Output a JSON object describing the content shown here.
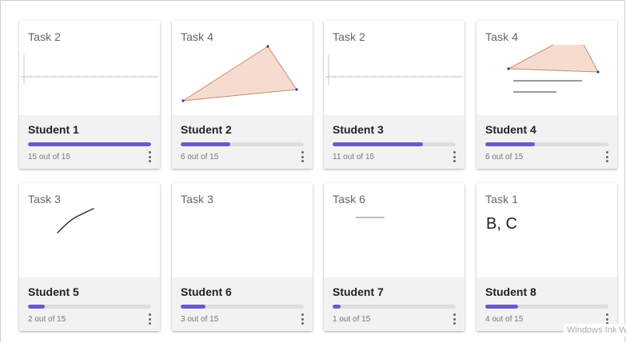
{
  "colors": {
    "accent": "#6a5acd",
    "track": "#dedede",
    "card_footer": "#f2f2f2"
  },
  "cards": [
    {
      "task": "Task 2",
      "student": "Student 1",
      "progress_text": "15 out of 15",
      "score": 15,
      "total": 15,
      "preview": "number-line"
    },
    {
      "task": "Task 4",
      "student": "Student 2",
      "progress_text": "6 out of 15",
      "score": 6,
      "total": 15,
      "preview": "triangle"
    },
    {
      "task": "Task 2",
      "student": "Student 3",
      "progress_text": "11 out of 15",
      "score": 11,
      "total": 15,
      "preview": "number-line"
    },
    {
      "task": "Task 4",
      "student": "Student 4",
      "progress_text": "6 out of 15",
      "score": 6,
      "total": 15,
      "preview": "triangle-with-equations"
    },
    {
      "task": "Task 3",
      "student": "Student 5",
      "progress_text": "2 out of 15",
      "score": 2,
      "total": 15,
      "preview": "sketch-line"
    },
    {
      "task": "Task 3",
      "student": "Student 6",
      "progress_text": "3 out of 15",
      "score": 3,
      "total": 15,
      "preview": "blank"
    },
    {
      "task": "Task 6",
      "student": "Student 7",
      "progress_text": "1 out of 15",
      "score": 1,
      "total": 15,
      "preview": "tiny-text"
    },
    {
      "task": "Task 1",
      "student": "Student 8",
      "progress_text": "4 out of 15",
      "score": 4,
      "total": 15,
      "preview": "answer-text",
      "answer": "B, C"
    }
  ],
  "overlay": {
    "watermark": "Windows Ink W"
  }
}
